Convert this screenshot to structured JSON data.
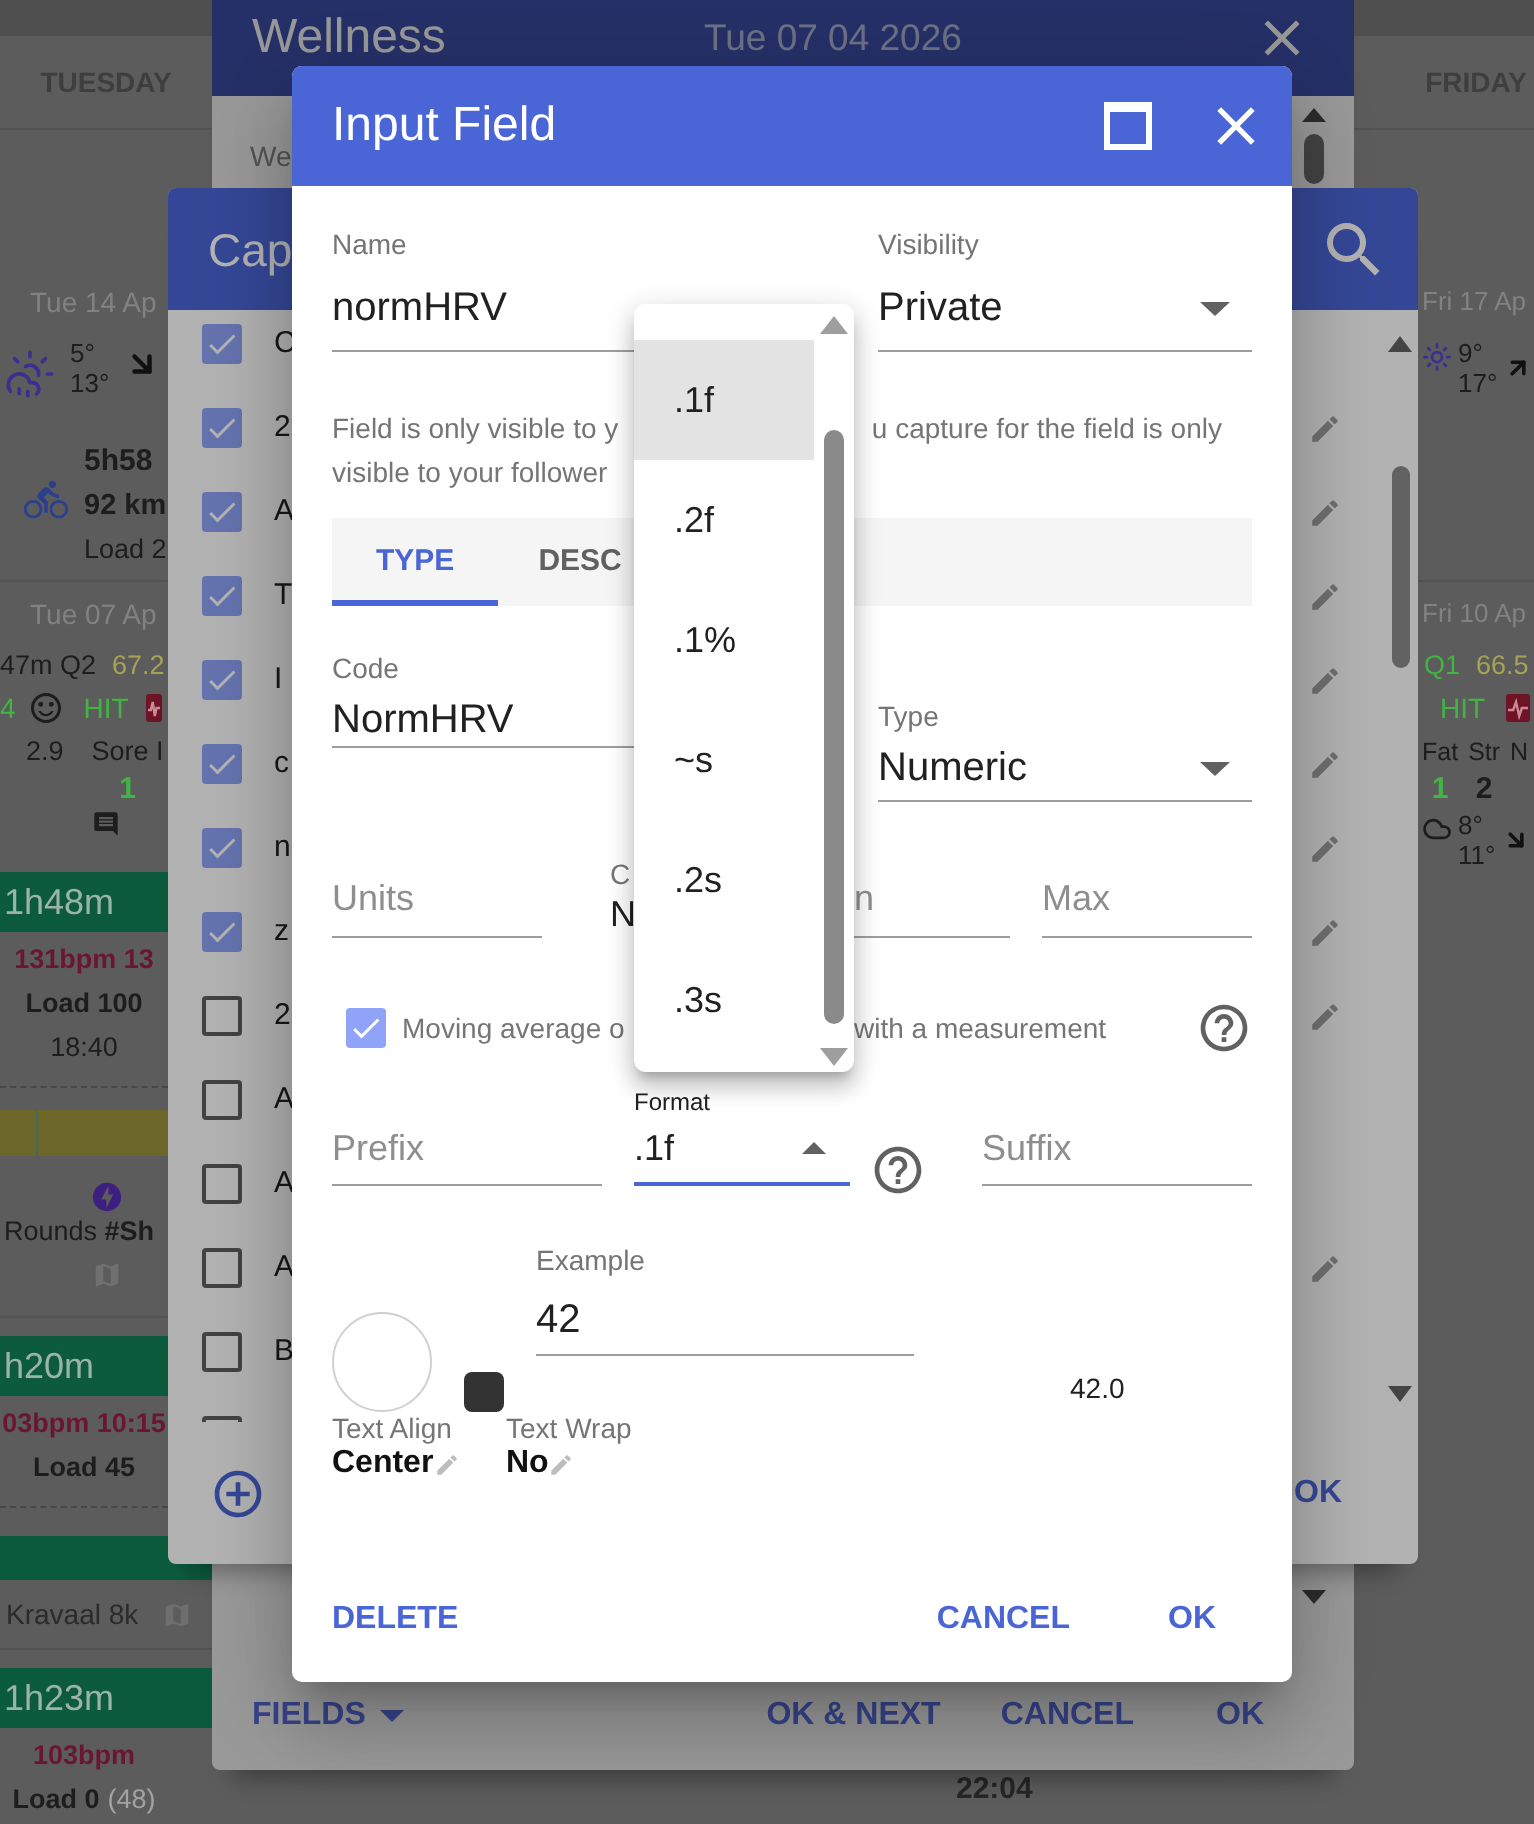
{
  "calendar": {
    "headers": [
      "TUESDAY",
      "FRIDAY"
    ],
    "weeks": [
      {
        "tuesday": [
          {
            "kind": "date",
            "text": "Tue 14 Ap"
          },
          {
            "kind": "weather",
            "temps": [
              "5°",
              "13°"
            ]
          },
          {
            "kind": "ride",
            "duration": "5h58",
            "distance": "92 km",
            "load": "Load 2"
          }
        ],
        "friday": [
          {
            "kind": "date",
            "text": "Fri 17 Ap"
          },
          {
            "kind": "weather",
            "temps": [
              "9°",
              "17°"
            ]
          }
        ]
      },
      {
        "tuesday": [
          {
            "kind": "date",
            "text": "Tue 07 Ap"
          },
          {
            "kind": "score_row",
            "label": "47m Q2",
            "color": "#1d1d1d",
            "score": "67.2"
          },
          {
            "kind": "feel_row",
            "value": "4",
            "tag": "HIT"
          },
          {
            "kind": "stats",
            "columns": [
              {
                "label": "2.9"
              },
              {
                "label": "Sore I",
                "value": "1",
                "color": "#42b442"
              }
            ]
          },
          {
            "kind": "comment"
          },
          {
            "kind": "session",
            "duration": "1h48m",
            "lines": [
              {
                "text": "131bpm 13",
                "kind": "heart_rate"
              },
              {
                "text": "Load 100",
                "kind": "load"
              },
              {
                "text": "18:40",
                "kind": "time"
              }
            ]
          },
          {
            "kind": "divider"
          },
          {
            "kind": "zone_bar"
          },
          {
            "kind": "event",
            "title": "Rounds **#Sh**"
          },
          {
            "kind": "session",
            "duration": "h20m",
            "lines": [
              {
                "text": "03bpm 10:15",
                "kind": "heart_rate"
              },
              {
                "text": "Load 45",
                "kind": "load"
              }
            ]
          },
          {
            "kind": "divider"
          },
          {
            "kind": "bar"
          },
          {
            "kind": "route",
            "title": "Kravaal 8k"
          },
          {
            "kind": "session",
            "duration": "1h23m",
            "lines": [
              {
                "text": "103bpm",
                "kind": "heart_rate"
              },
              {
                "text": "Load 0",
                "note": "(48)",
                "kind": "load"
              }
            ]
          }
        ],
        "thursday": [
          {
            "kind": "time",
            "text": "22:04"
          }
        ],
        "friday": [
          {
            "kind": "date",
            "text": "Fri 10 Ap"
          },
          {
            "kind": "score_row",
            "label": "Q1",
            "color": "#42b442",
            "score": "66.5"
          },
          {
            "kind": "tag_row",
            "tag": "HIT"
          },
          {
            "kind": "stats",
            "columns": [
              {
                "label": "Fat",
                "value": "1",
                "color": "#42b442"
              },
              {
                "label": "Str",
                "value": "2",
                "color": "#1d1d1d"
              },
              {
                "label": "N"
              }
            ]
          },
          {
            "kind": "weather",
            "temps": [
              "8°",
              "11°"
            ]
          }
        ]
      }
    ]
  },
  "wellness": {
    "title": "Wellness",
    "date": "Tue 07 04 2026",
    "body_text": "We",
    "buttons": [
      {
        "label": "FIELDS",
        "kind": "menu"
      },
      {
        "label": "OK & NEXT",
        "kind": "text"
      },
      {
        "label": "CANCEL",
        "kind": "text"
      },
      {
        "label": "OK",
        "kind": "text"
      }
    ]
  },
  "capture": {
    "title": "Cap",
    "rows": [
      {
        "label": "C",
        "checked": true,
        "editable": false
      },
      {
        "label": "2",
        "checked": true,
        "editable": true
      },
      {
        "label": "A",
        "checked": true,
        "editable": true
      },
      {
        "label": "T",
        "checked": true,
        "editable": true
      },
      {
        "label": "I",
        "checked": true,
        "editable": true
      },
      {
        "label": "c",
        "checked": true,
        "editable": true
      },
      {
        "label": "n",
        "checked": true,
        "editable": true
      },
      {
        "label": "z",
        "checked": true,
        "editable": true
      },
      {
        "label": "2",
        "checked": false,
        "editable": true
      },
      {
        "label": "A",
        "checked": false,
        "editable": false
      },
      {
        "label": "A",
        "checked": false,
        "editable": false
      },
      {
        "label": "A",
        "checked": false,
        "editable": true
      },
      {
        "label": "B",
        "checked": false,
        "editable": false
      },
      {
        "checked": false,
        "editable": false
      }
    ],
    "buttons": [
      {
        "label": "OK"
      }
    ]
  },
  "input_field": {
    "title": "Input Field",
    "name": {
      "label": "Name",
      "value": "normHRV"
    },
    "visibility": {
      "label": "Visibility",
      "value": "Private"
    },
    "help_text": [
      "Field is only visible to y",
      "u capture for the field is only",
      "visible to your follower"
    ],
    "tabs": [
      {
        "label": "TYPE",
        "selected": true
      },
      {
        "label": "DESC",
        "selected": false
      }
    ],
    "code": {
      "label": "Code",
      "value": "NormHRV"
    },
    "type": {
      "label": "Type",
      "value": "Numeric"
    },
    "range_fields": [
      {
        "kind": "input",
        "placeholder": "Units"
      },
      {
        "kind": "display",
        "label": "C",
        "value": "N"
      },
      {
        "kind": "input",
        "placeholder": "n"
      },
      {
        "kind": "input",
        "placeholder": "Max"
      }
    ],
    "moving_average": {
      "checked": true,
      "label": "Moving average o",
      "label_end": "with a measurement"
    },
    "prefix": {
      "placeholder": "Prefix"
    },
    "format": {
      "label": "Format",
      "value": ".1f",
      "expanded": true
    },
    "suffix": {
      "placeholder": "Suffix"
    },
    "swatches": [
      {
        "kind": "circle",
        "color": "#ffffff"
      },
      {
        "kind": "square",
        "color": "#333333"
      }
    ],
    "example": {
      "label": "Example",
      "value": "42",
      "preview": "42.0"
    },
    "text_align": {
      "label": "Text Align",
      "value": "Center"
    },
    "text_wrap": {
      "label": "Text Wrap",
      "value": "No"
    },
    "buttons": [
      {
        "label": "DELETE"
      },
      {
        "label": "CANCEL"
      },
      {
        "label": "OK"
      }
    ],
    "format_menu": {
      "options": [
        {
          "label": ".1f",
          "selected": true
        },
        {
          "label": ".2f",
          "selected": false
        },
        {
          "label": ".1%",
          "selected": false
        },
        {
          "label": "~s",
          "selected": false
        },
        {
          "label": ".2s",
          "selected": false
        },
        {
          "label": ".3s",
          "selected": false
        }
      ]
    }
  }
}
